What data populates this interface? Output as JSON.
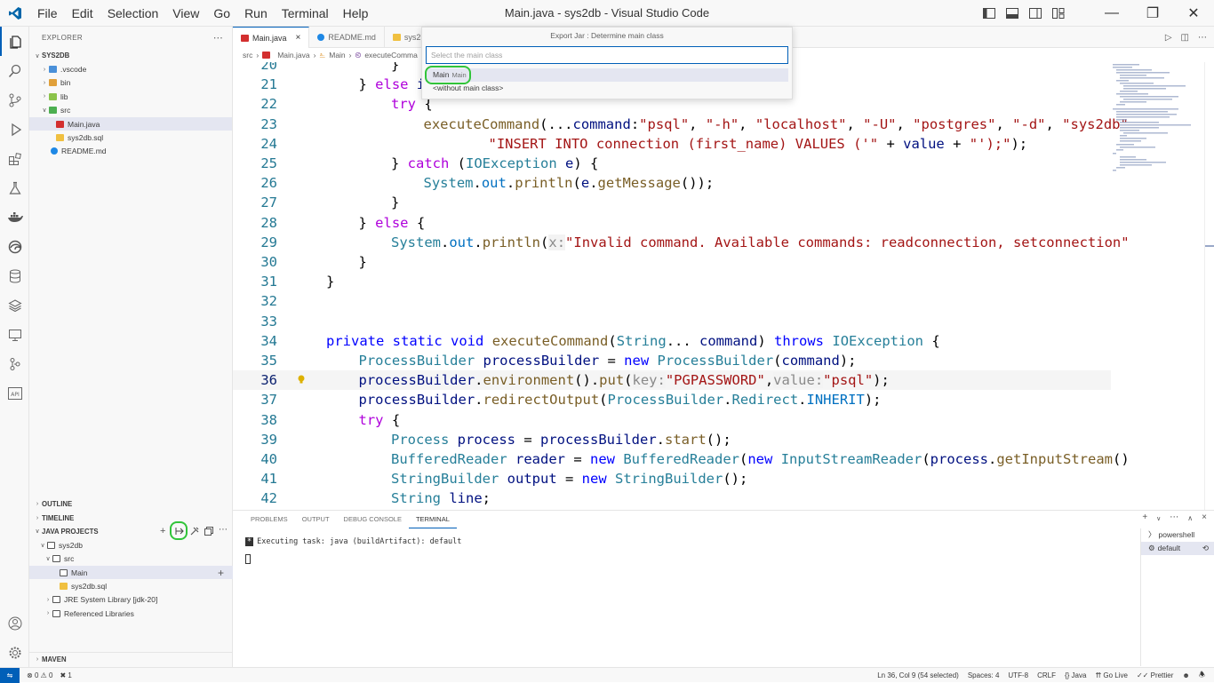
{
  "window": {
    "title": "Main.java - sys2db - Visual Studio Code",
    "menu": [
      "File",
      "Edit",
      "Selection",
      "View",
      "Go",
      "Run",
      "Terminal",
      "Help"
    ]
  },
  "explorer": {
    "header": "EXPLORER",
    "root": "SYS2DB",
    "items": [
      {
        "label": ".vscode",
        "type": "folder",
        "icon": "folder-vscode-icon"
      },
      {
        "label": "bin",
        "type": "folder",
        "icon": "folder-bin-icon"
      },
      {
        "label": "lib",
        "type": "folder",
        "icon": "folder-lib-icon"
      },
      {
        "label": "src",
        "type": "folder",
        "icon": "folder-src-icon"
      },
      {
        "label": "Main.java",
        "type": "file",
        "icon": "java-file-icon"
      },
      {
        "label": "sys2db.sql",
        "type": "file",
        "icon": "sql-file-icon"
      },
      {
        "label": "README.md",
        "type": "file",
        "icon": "info-file-icon"
      }
    ]
  },
  "sections": {
    "outline": "OUTLINE",
    "timeline": "TIMELINE",
    "java_projects": "JAVA PROJECTS",
    "maven": "MAVEN"
  },
  "java_projects": {
    "project": "sys2db",
    "src": "src",
    "main": "Main",
    "sql": "sys2db.sql",
    "jre": "JRE System Library [jdk-20]",
    "refs": "Referenced Libraries"
  },
  "tabs": [
    {
      "label": "Main.java",
      "active": true
    },
    {
      "label": "README.md",
      "active": false
    },
    {
      "label": "sys2",
      "active": false
    }
  ],
  "breadcrumb": [
    "src",
    "Main.java",
    "Main",
    "executeComma"
  ],
  "quickpick": {
    "title": "Export Jar : Determine main class",
    "placeholder": "Select the main class",
    "items": [
      {
        "label": "Main",
        "desc": "Main"
      },
      {
        "label": "<without main class>",
        "desc": ""
      }
    ]
  },
  "code": {
    "current_line": 36,
    "lines": [
      {
        "n": "20",
        "indent": 2,
        "html": "}"
      },
      {
        "n": "21",
        "indent": 1,
        "html": "} else i"
      },
      {
        "n": "22",
        "indent": 2,
        "html": "try {"
      },
      {
        "n": "23",
        "indent": 3,
        "html": "executeCommand(...command:\"psql\", \"-h\", \"localhost\", \"-U\", \"postgres\", \"-d\", \"sys2db\""
      },
      {
        "n": "24",
        "indent": 5,
        "html": "\"INSERT INTO connection (first_name) VALUES ('\" + value + \"');\");"
      },
      {
        "n": "25",
        "indent": 2,
        "html": "} catch (IOException e) {"
      },
      {
        "n": "26",
        "indent": 3,
        "html": "System.out.println(e.getMessage());"
      },
      {
        "n": "27",
        "indent": 2,
        "html": "}"
      },
      {
        "n": "28",
        "indent": 1,
        "html": "} else {"
      },
      {
        "n": "29",
        "indent": 2,
        "html": "System.out.println(x:\"Invalid command. Available commands: readconnection, setconnection\""
      },
      {
        "n": "30",
        "indent": 1,
        "html": "}"
      },
      {
        "n": "31",
        "indent": 0,
        "html": "}"
      },
      {
        "n": "32",
        "indent": 0,
        "html": ""
      },
      {
        "n": "33",
        "indent": 0,
        "html": ""
      },
      {
        "n": "34",
        "indent": 0,
        "html": "private static void executeCommand(String... command) throws IOException {"
      },
      {
        "n": "35",
        "indent": 1,
        "html": "ProcessBuilder processBuilder = new ProcessBuilder(command);"
      },
      {
        "n": "36",
        "indent": 1,
        "html": "processBuilder.environment().put(key:\"PGPASSWORD\",value:\"psql\");"
      },
      {
        "n": "37",
        "indent": 1,
        "html": "processBuilder.redirectOutput(ProcessBuilder.Redirect.INHERIT);"
      },
      {
        "n": "38",
        "indent": 1,
        "html": "try {"
      },
      {
        "n": "39",
        "indent": 2,
        "html": "Process process = processBuilder.start();"
      },
      {
        "n": "40",
        "indent": 2,
        "html": "BufferedReader reader = new BufferedReader(new InputStreamReader(process.getInputStream()"
      },
      {
        "n": "41",
        "indent": 2,
        "html": "StringBuilder output = new StringBuilder();"
      },
      {
        "n": "42",
        "indent": 2,
        "html": "String line;"
      }
    ]
  },
  "panel": {
    "tabs": [
      "PROBLEMS",
      "OUTPUT",
      "DEBUG CONSOLE",
      "TERMINAL"
    ],
    "active_tab": "TERMINAL",
    "terminal_line": "Executing task: java (buildArtifact): default",
    "terminals": [
      "powershell",
      "default"
    ]
  },
  "status": {
    "errors": "0",
    "warnings": "0",
    "ports": "1",
    "position": "Ln 36, Col 9 (54 selected)",
    "spaces": "Spaces: 4",
    "encoding": "UTF-8",
    "eol": "CRLF",
    "language": "Java",
    "golive": "Go Live",
    "prettier": "Prettier"
  },
  "colors": {
    "accent": "#005fb8",
    "highlight_circle": "#31c43a"
  }
}
